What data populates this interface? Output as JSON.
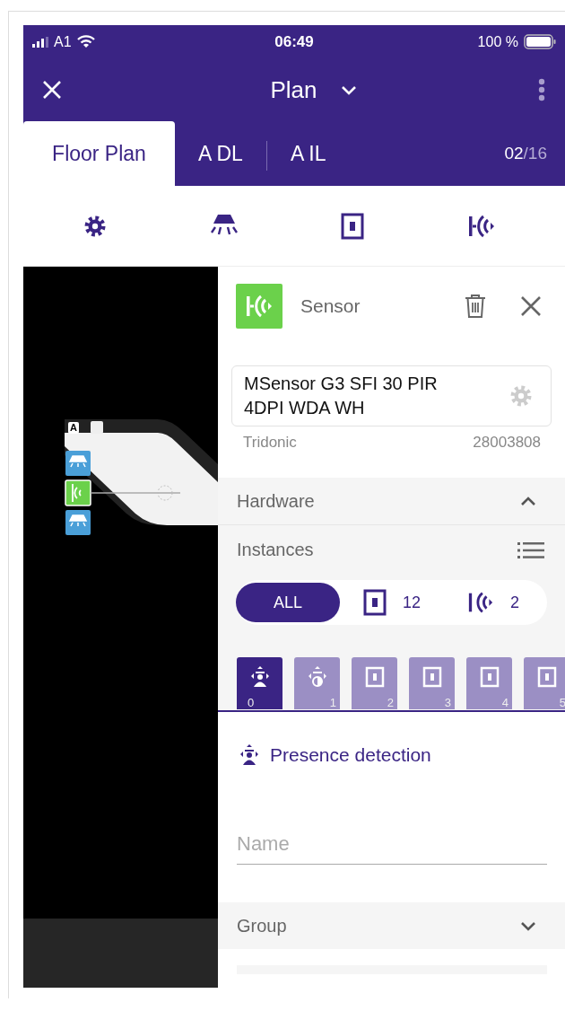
{
  "status_bar": {
    "carrier": "A1",
    "time": "06:49",
    "battery": "100 %"
  },
  "header": {
    "title": "Plan"
  },
  "tabs": [
    {
      "label": "Floor Plan",
      "selected": true
    },
    {
      "label": "A DL",
      "selected": false
    },
    {
      "label": "A IL",
      "selected": false
    }
  ],
  "page_counter": {
    "current": "02",
    "total": "/16"
  },
  "toolbar": [
    {
      "kind": "settings"
    },
    {
      "kind": "lamp"
    },
    {
      "kind": "switch"
    },
    {
      "kind": "sensor"
    }
  ],
  "canvas": {
    "badge": "A"
  },
  "panel": {
    "type": "Sensor",
    "product": "MSensor G3 SFI 30 PIR 4DPI WDA WH",
    "manufacturer": "Tridonic",
    "article": "28003808",
    "hardware": {
      "title": "Hardware",
      "expanded": true
    },
    "instances": {
      "title": "Instances",
      "filters": [
        {
          "kind": "all",
          "label": "ALL",
          "selected": true
        },
        {
          "kind": "switch",
          "count": "12",
          "selected": false
        },
        {
          "kind": "sensor",
          "count": "2",
          "selected": false
        }
      ],
      "tabs": [
        {
          "kind": "presence",
          "index": "0",
          "selected": true
        },
        {
          "kind": "light",
          "index": "1",
          "selected": false
        },
        {
          "kind": "switch",
          "index": "2",
          "selected": false
        },
        {
          "kind": "switch",
          "index": "3",
          "selected": false
        },
        {
          "kind": "switch",
          "index": "4",
          "selected": false
        },
        {
          "kind": "switch",
          "index": "5",
          "selected": false
        }
      ]
    },
    "detail": {
      "title": "Presence detection",
      "name_placeholder": "Name"
    },
    "group": {
      "title": "Group",
      "expanded": false
    }
  }
}
